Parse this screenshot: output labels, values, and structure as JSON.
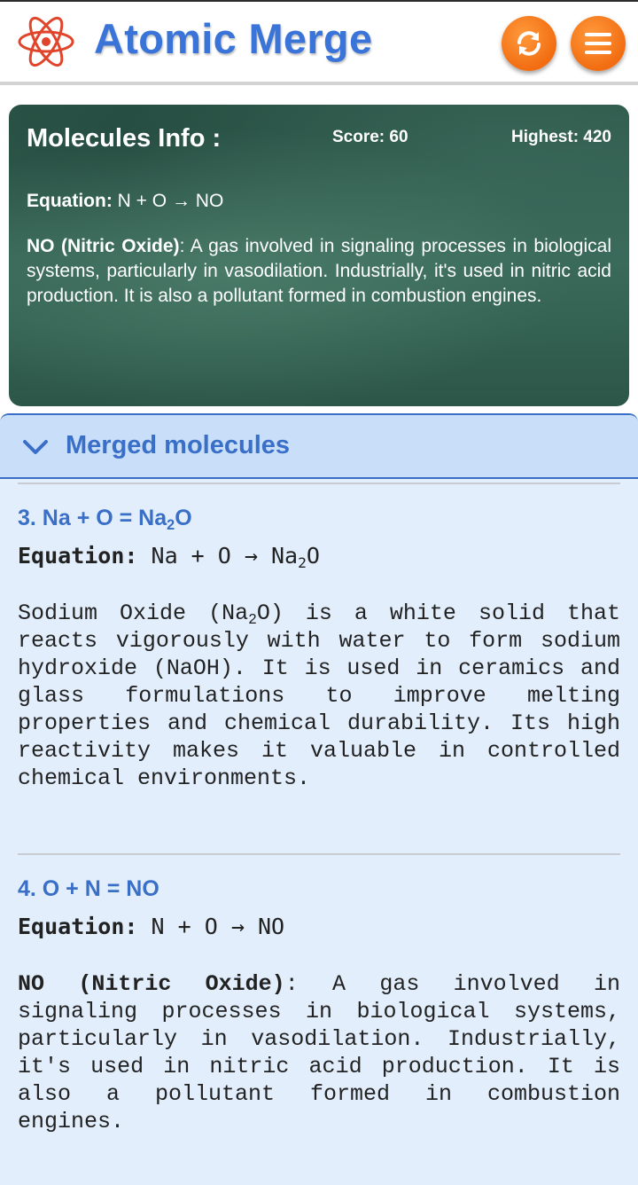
{
  "app": {
    "title": "Atomic Merge",
    "accent": "#3a74d8",
    "button_color": "#f26d12",
    "icons": {
      "logo": "atom-icon",
      "refresh": "refresh-icon",
      "menu": "hamburger-menu-icon"
    }
  },
  "info": {
    "title": "Molecules Info :",
    "score": "Score: 60",
    "highest": "Highest: 420",
    "equation_label": "Equation:",
    "equation": "N + O → NO",
    "name": "NO (Nitric Oxide)",
    "description": ": A gas involved in signaling processes in biological systems, particularly in vasodilation. Industrially, it's used in nitric acid production. It is also a pollutant formed in combustion engines."
  },
  "merged": {
    "title": "Merged molecules",
    "icon": "chevron-down-icon",
    "entries": [
      {
        "title_prefix": "3. Na + O = Na",
        "title_sub": "2",
        "title_suffix": "O",
        "equation_label": "Equation:",
        "equation_prefix": "Na + O → Na",
        "equation_sub": "2",
        "equation_suffix": "O",
        "desc_prefix": "Sodium Oxide (Na",
        "desc_sub": "2",
        "desc_suffix": "O) is a white solid that reacts vigorously with water to form sodium hydroxide (NaOH). It is used in ceramics and glass formulations to improve melting properties and chemical durability. Its high reactivity makes it valuable in controlled chemical environments."
      },
      {
        "title": "4. O + N = NO",
        "equation_label": "Equation:",
        "equation": "N + O → NO",
        "name": "NO (Nitric Oxide)",
        "description": ": A gas involved in signaling processes in biological systems, particularly in vasodilation. Industrially, it's used in nitric acid production. It is also a pollutant formed in combustion engines."
      }
    ]
  }
}
